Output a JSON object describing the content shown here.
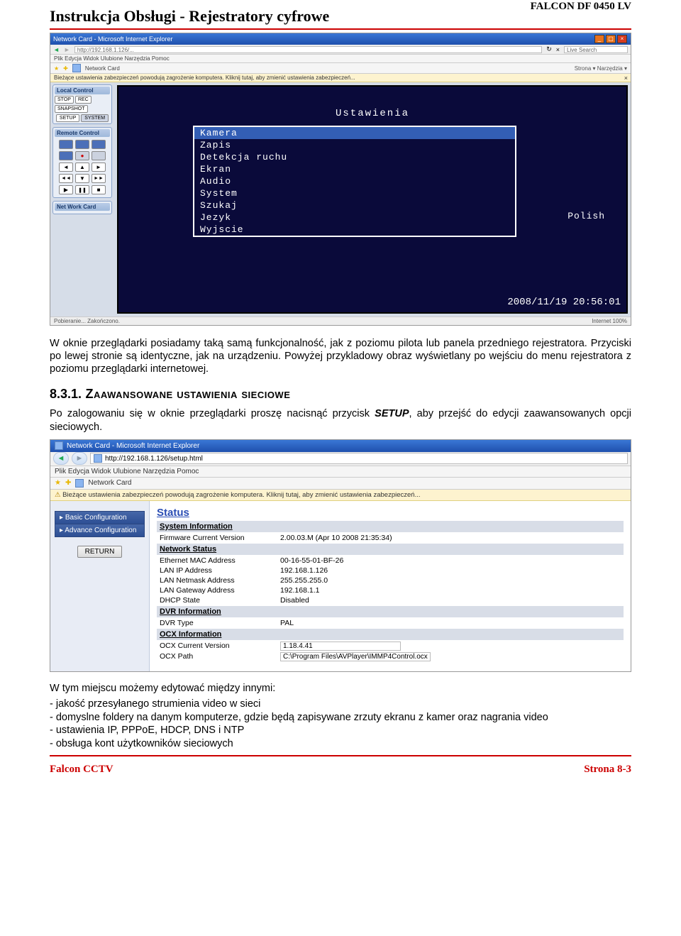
{
  "header": {
    "title_left": "Instrukcja Obsługi - Rejestratory cyfrowe",
    "title_right": "FALCON DF 0450 LV"
  },
  "shot1": {
    "window_title": "Network Card - Microsoft Internet Explorer",
    "address": "http://192.168.1.126/...",
    "search_hint": "Live Search",
    "menu": "Plik    Edycja    Widok    Ulubione    Narzędzia    Pomoc",
    "tab": "Network Card",
    "star_right": "Strona ▾    Narzędzia ▾",
    "warn": "Bieżące ustawienia zabezpieczeń powodują zagrożenie komputera. Kliknij tutaj, aby zmienić ustawienia zabezpieczeń...",
    "local_control": {
      "title": "Local Control",
      "btns": [
        "STOP",
        "REC",
        "SNAPSHOT"
      ],
      "btns2": [
        "SETUP",
        "SYSTEM"
      ]
    },
    "remote_control_title": "Remote Control",
    "network_card_title": "Net Work Card",
    "dvr": {
      "title": "Ustawienia",
      "items": [
        "Kamera",
        "Zapis",
        "Detekcja ruchu",
        "Ekran",
        "Audio",
        "System",
        "Szukaj",
        "Jezyk",
        "Wyjscie"
      ],
      "selected_index": 0,
      "lang_value": "Polish",
      "timestamp": "2008/11/19 20:56:01"
    },
    "status_left": "Pobieranie... Zakończono.",
    "status_right": "Internet      100%"
  },
  "para1": "W oknie przeglądarki posiadamy taką samą funkcjonalność, jak z poziomu pilota lub panela przedniego rejestratora. Przyciski po lewej stronie są identyczne, jak na urządzeniu. Powyżej przykladowy obraz wyświetlany po wejściu do menu rejestratora z poziomu przeglądarki internetowej.",
  "section": {
    "num": "8.3.1.",
    "title": " Zaawansowane ustawienia sieciowe"
  },
  "para2_a": "Po zalogowaniu się w oknie przeglądarki proszę nacisnąć przycisk ",
  "para2_setup": "SETUP",
  "para2_b": ", aby przejść do edycji zaawansowanych opcji sieciowych.",
  "shot2": {
    "window_title": "Network Card - Microsoft Internet Explorer",
    "address": "http://192.168.1.126/setup.html",
    "menu": "Plik    Edycja    Widok    Ulubione    Narzędzia    Pomoc",
    "tab": "Network Card",
    "warn": "Bieżące ustawienia zabezpieczeń powodują zagrożenie komputera. Kliknij tutaj, aby zmienić ustawienia zabezpieczeń...",
    "side_items": [
      "Basic Configuration",
      "Advance Configuration"
    ],
    "return_label": "RETURN",
    "status_title": "Status",
    "groups": {
      "sysinfo": {
        "title": "System Information",
        "rows": [
          [
            "Firmware Current Version",
            "2.00.03.M (Apr 10 2008 21:35:34)"
          ]
        ]
      },
      "netstatus": {
        "title": "Network Status",
        "rows": [
          [
            "Ethernet MAC Address",
            "00-16-55-01-BF-26"
          ],
          [
            "LAN IP Address",
            "192.168.1.126"
          ],
          [
            "LAN Netmask Address",
            "255.255.255.0"
          ],
          [
            "LAN Gateway Address",
            "192.168.1.1"
          ],
          [
            "DHCP State",
            "Disabled"
          ]
        ]
      },
      "dvrinfo": {
        "title": "DVR Information",
        "rows": [
          [
            "DVR Type",
            "PAL"
          ]
        ]
      },
      "ocxinfo": {
        "title": "OCX Information",
        "rows": [
          [
            "OCX Current Version",
            "1.18.4.41"
          ],
          [
            "OCX Path",
            "C:\\Program Files\\AVPlayer\\IMMP4Control.ocx"
          ]
        ],
        "boxed": [
          true,
          true
        ]
      }
    }
  },
  "para3_intro": "W tym miejscu możemy edytować między innymi:",
  "bullets": [
    "- jakość przesyłanego strumienia video w sieci",
    "- domyslne foldery na danym komputerze, gdzie będą zapisywane zrzuty ekranu z kamer oraz nagrania video",
    "- ustawienia IP, PPPoE, HDCP, DNS i NTP",
    "- obsługa kont użytkowników sieciowych"
  ],
  "footer": {
    "left": "Falcon CCTV",
    "right": "Strona 8-3"
  }
}
